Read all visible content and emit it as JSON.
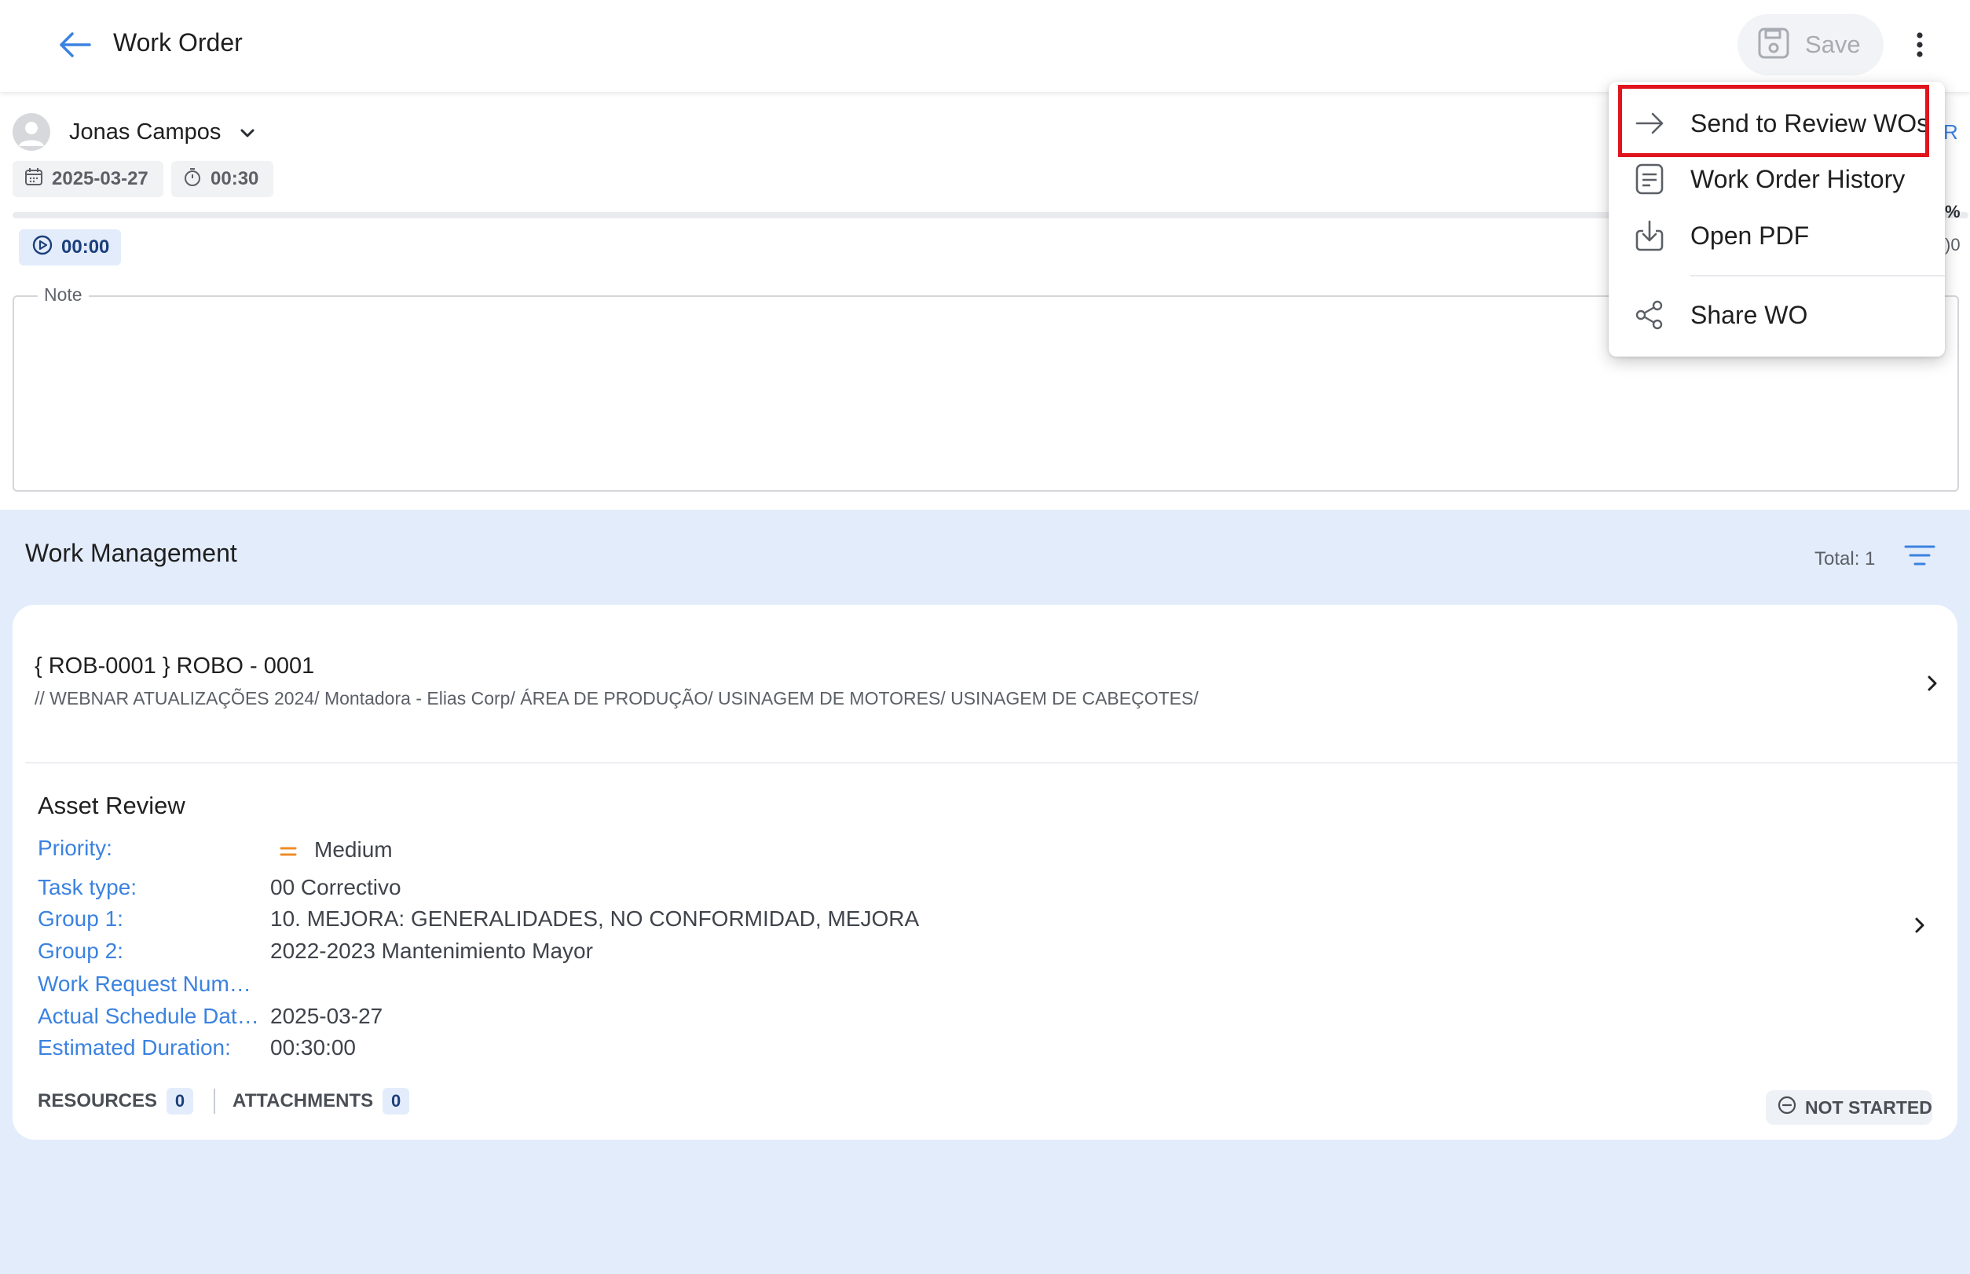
{
  "header": {
    "title": "Work Order",
    "save_label": "Save"
  },
  "top": {
    "user_name": "Jonas Campos",
    "date": "2025-03-27",
    "duration": "00:30",
    "timer": "00:00",
    "note_label": "Note",
    "edge_fragment_1": "R",
    "edge_fragment_2": "%",
    "edge_fragment_3": ")0"
  },
  "work_management": {
    "title": "Work Management",
    "total_label": "Total: 1"
  },
  "asset": {
    "name": "{ ROB-0001 } ROBO - 0001",
    "path": "// WEBNAR ATUALIZAÇÕES 2024/ Montadora - Elias Corp/ ÁREA DE PRODUÇÃO/ USINAGEM DE MOTORES/ USINAGEM DE CABEÇOTES/"
  },
  "review": {
    "title": "Asset Review",
    "fields": [
      {
        "label": "Priority:",
        "value": "Medium"
      },
      {
        "label": "Task type:",
        "value": "00 Correctivo"
      },
      {
        "label": "Group 1:",
        "value": "10. MEJORA: GENERALIDADES, NO CONFORMIDAD, MEJORA"
      },
      {
        "label": "Group 2:",
        "value": "2022-2023 Mantenimiento Mayor"
      },
      {
        "label": "Work Request Num…",
        "value": ""
      },
      {
        "label": "Actual Schedule Dat…",
        "value": "2025-03-27"
      },
      {
        "label": "Estimated Duration:",
        "value": "00:30:00"
      }
    ],
    "priority_color": "#f08c2a"
  },
  "tabs": {
    "resources_label": "RESOURCES",
    "resources_count": "0",
    "attachments_label": "ATTACHMENTS",
    "attachments_count": "0"
  },
  "status": {
    "label": "NOT STARTED"
  },
  "menu": {
    "items": [
      {
        "label": "Send to Review WOs",
        "icon": "arrow-right-icon"
      },
      {
        "label": "Work Order History",
        "icon": "history-doc-icon"
      },
      {
        "label": "Open PDF",
        "icon": "download-icon"
      },
      {
        "label": "Share WO",
        "icon": "share-icon"
      }
    ],
    "highlight_color": "#e0141e"
  },
  "colors": {
    "accent_blue": "#3b82e0",
    "page_background": "#e3ecfb"
  }
}
